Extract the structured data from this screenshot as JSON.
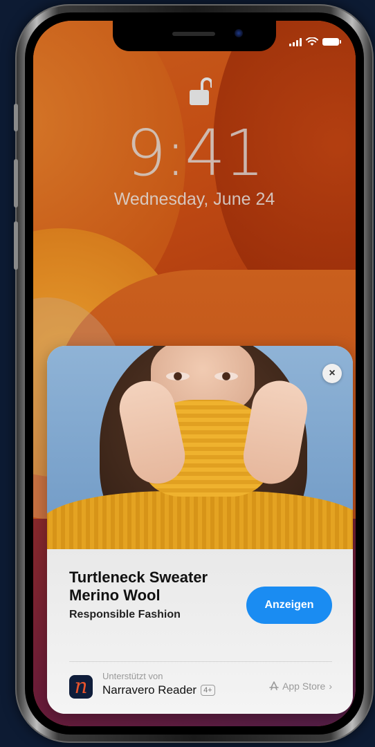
{
  "lockscreen": {
    "time": "9:41",
    "date": "Wednesday, June 24"
  },
  "status_bar": {
    "icons": [
      "signal-icon",
      "wifi-icon",
      "battery-icon"
    ]
  },
  "ad_card": {
    "close_icon": "×",
    "title_line1": "Turtleneck Sweater",
    "title_line2": "Merino Wool",
    "subtitle": "Responsible Fashion",
    "cta_label": "Anzeigen",
    "supported_by": "Unterstützt von",
    "app_name": "Narravero Reader",
    "age_rating": "4+",
    "store_label": "App Store",
    "store_chevron": "›",
    "app_icon_glyph": "n"
  },
  "colors": {
    "cta": "#1a8cf2",
    "app_icon_bg": "#0f1d3a",
    "app_icon_fg": "#e9542c",
    "page_bg": "#0d1b33"
  }
}
